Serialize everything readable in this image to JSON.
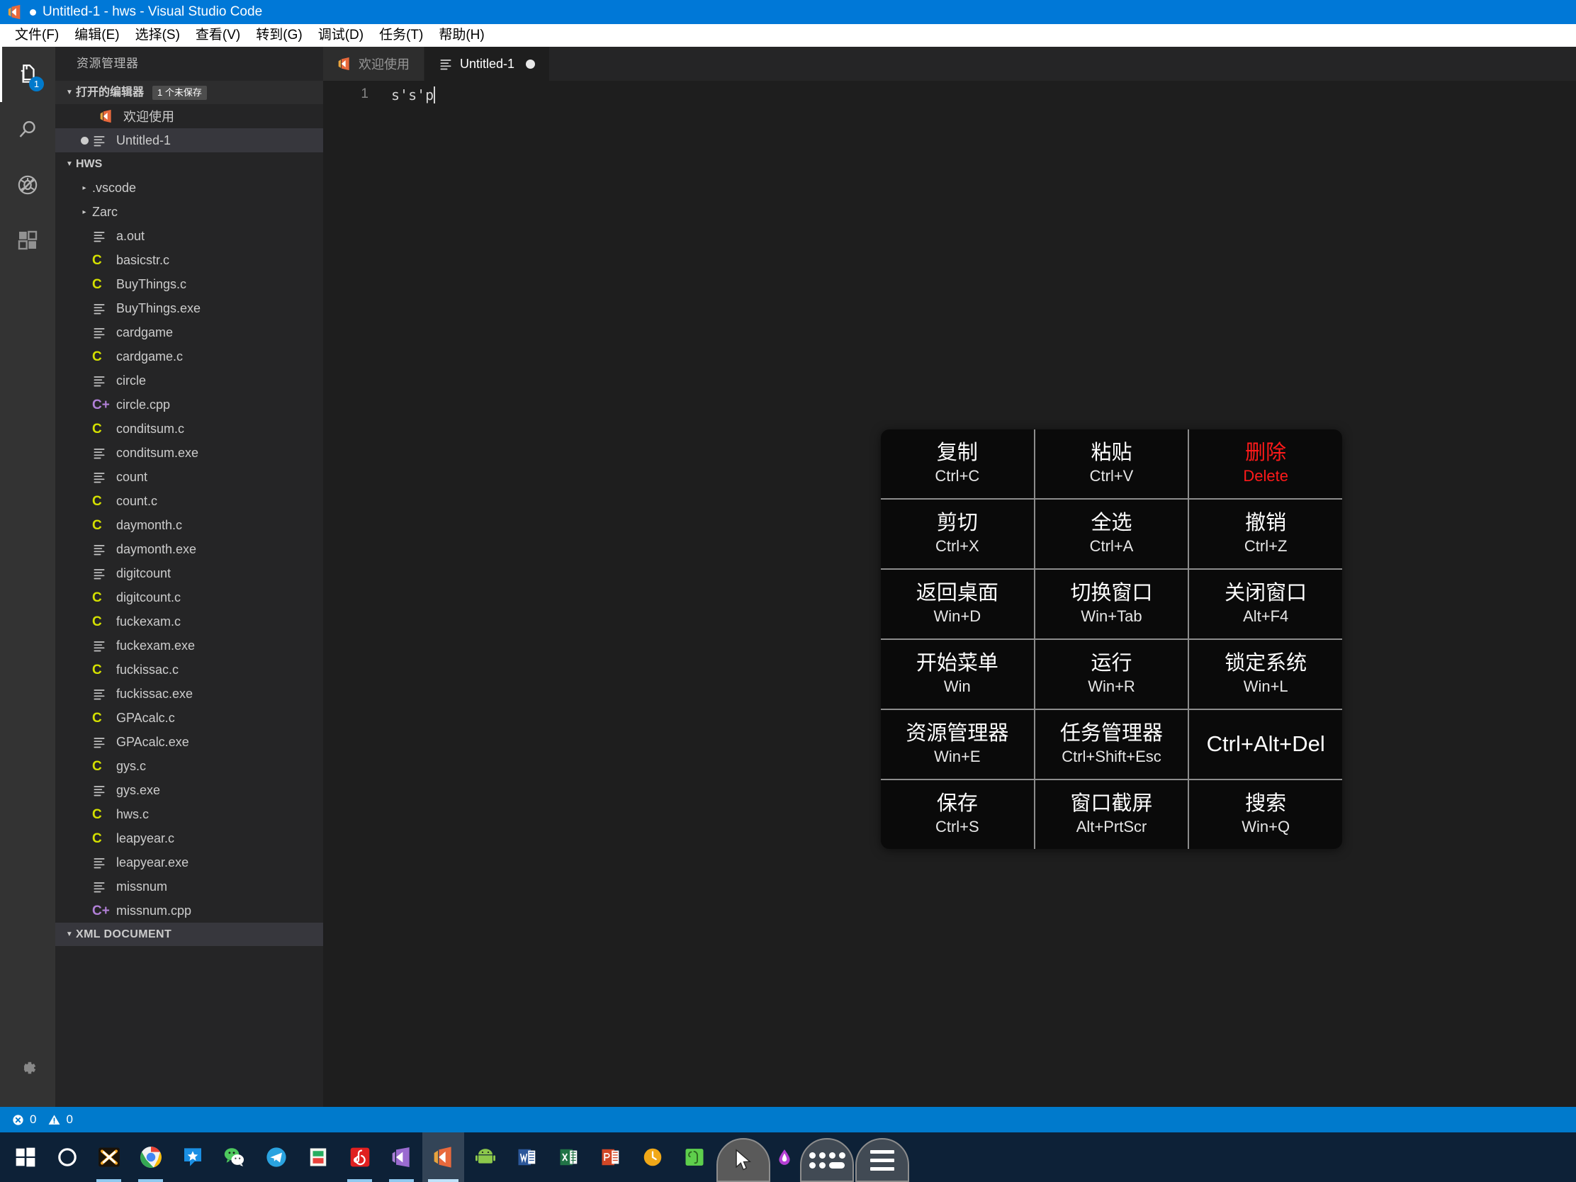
{
  "window": {
    "title": "Untitled-1 - hws - Visual Studio Code",
    "dirty": true
  },
  "menubar": {
    "items": [
      {
        "label": "文件(F)"
      },
      {
        "label": "编辑(E)"
      },
      {
        "label": "选择(S)"
      },
      {
        "label": "查看(V)"
      },
      {
        "label": "转到(G)"
      },
      {
        "label": "调试(D)"
      },
      {
        "label": "任务(T)"
      },
      {
        "label": "帮助(H)"
      }
    ]
  },
  "activitybar": {
    "items": [
      {
        "name": "explorer",
        "icon": "files-icon",
        "badge": "1",
        "active": true
      },
      {
        "name": "search",
        "icon": "search-icon",
        "badge": "",
        "active": false
      },
      {
        "name": "debug",
        "icon": "no-debug-icon",
        "badge": "",
        "active": false
      },
      {
        "name": "extensions",
        "icon": "extensions-icon",
        "badge": "",
        "active": false
      }
    ],
    "settings": {
      "name": "settings",
      "icon": "gear-icon"
    }
  },
  "sidebar": {
    "title": "资源管理器",
    "open_editors": {
      "label": "打开的编辑器",
      "badge": "1 个未保存",
      "items": [
        {
          "label": "欢迎使用",
          "icon": "vscode-icon",
          "dirty": false,
          "selected": false
        },
        {
          "label": "Untitled-1",
          "icon": "file-lines-icon",
          "dirty": true,
          "selected": true
        }
      ]
    },
    "folder": {
      "label": "HWS",
      "items": [
        {
          "label": ".vscode",
          "type": "folder"
        },
        {
          "label": "Zarc",
          "type": "folder"
        },
        {
          "label": "a.out",
          "type": "plain"
        },
        {
          "label": "basicstr.c",
          "type": "c"
        },
        {
          "label": "BuyThings.c",
          "type": "c"
        },
        {
          "label": "BuyThings.exe",
          "type": "plain"
        },
        {
          "label": "cardgame",
          "type": "plain"
        },
        {
          "label": "cardgame.c",
          "type": "c"
        },
        {
          "label": "circle",
          "type": "plain"
        },
        {
          "label": "circle.cpp",
          "type": "cpp"
        },
        {
          "label": "conditsum.c",
          "type": "c"
        },
        {
          "label": "conditsum.exe",
          "type": "plain"
        },
        {
          "label": "count",
          "type": "plain"
        },
        {
          "label": "count.c",
          "type": "c"
        },
        {
          "label": "daymonth.c",
          "type": "c"
        },
        {
          "label": "daymonth.exe",
          "type": "plain"
        },
        {
          "label": "digitcount",
          "type": "plain"
        },
        {
          "label": "digitcount.c",
          "type": "c"
        },
        {
          "label": "fuckexam.c",
          "type": "c"
        },
        {
          "label": "fuckexam.exe",
          "type": "plain"
        },
        {
          "label": "fuckissac.c",
          "type": "c"
        },
        {
          "label": "fuckissac.exe",
          "type": "plain"
        },
        {
          "label": "GPAcalc.c",
          "type": "c"
        },
        {
          "label": "GPAcalc.exe",
          "type": "plain"
        },
        {
          "label": "gys.c",
          "type": "c"
        },
        {
          "label": "gys.exe",
          "type": "plain"
        },
        {
          "label": "hws.c",
          "type": "c"
        },
        {
          "label": "leapyear.c",
          "type": "c"
        },
        {
          "label": "leapyear.exe",
          "type": "plain"
        },
        {
          "label": "missnum",
          "type": "plain"
        },
        {
          "label": "missnum.cpp",
          "type": "cpp"
        }
      ]
    },
    "xml_document": {
      "label": "XML DOCUMENT"
    }
  },
  "editor": {
    "tabs": [
      {
        "label": "欢迎使用",
        "icon": "vscode-icon",
        "active": false,
        "dirty": false
      },
      {
        "label": "Untitled-1",
        "icon": "file-lines-icon",
        "active": true,
        "dirty": true
      }
    ],
    "line_number": "1",
    "content": "s's'p"
  },
  "shortcut_panel": {
    "rows": [
      [
        {
          "label": "复制",
          "key": "Ctrl+C",
          "danger": false
        },
        {
          "label": "粘贴",
          "key": "Ctrl+V",
          "danger": false
        },
        {
          "label": "删除",
          "key": "Delete",
          "danger": true
        }
      ],
      [
        {
          "label": "剪切",
          "key": "Ctrl+X",
          "danger": false
        },
        {
          "label": "全选",
          "key": "Ctrl+A",
          "danger": false
        },
        {
          "label": "撤销",
          "key": "Ctrl+Z",
          "danger": false
        }
      ],
      [
        {
          "label": "返回桌面",
          "key": "Win+D",
          "danger": false
        },
        {
          "label": "切换窗口",
          "key": "Win+Tab",
          "danger": false
        },
        {
          "label": "关闭窗口",
          "key": "Alt+F4",
          "danger": false
        }
      ],
      [
        {
          "label": "开始菜单",
          "key": "Win",
          "danger": false
        },
        {
          "label": "运行",
          "key": "Win+R",
          "danger": false
        },
        {
          "label": "锁定系统",
          "key": "Win+L",
          "danger": false
        }
      ],
      [
        {
          "label": "资源管理器",
          "key": "Win+E",
          "danger": false
        },
        {
          "label": "任务管理器",
          "key": "Ctrl+Shift+Esc",
          "danger": false
        },
        {
          "label": "Ctrl+Alt+Del",
          "key": "",
          "danger": false
        }
      ],
      [
        {
          "label": "保存",
          "key": "Ctrl+S",
          "danger": false
        },
        {
          "label": "窗口截屏",
          "key": "Alt+PrtScr",
          "danger": false
        },
        {
          "label": "搜索",
          "key": "Win+Q",
          "danger": false
        }
      ]
    ]
  },
  "statusbar": {
    "errors": "0",
    "warnings": "0"
  },
  "taskbar": {
    "items": [
      {
        "name": "start-icon",
        "kind": "start"
      },
      {
        "name": "cortana-icon",
        "kind": "cortana"
      },
      {
        "name": "xmind-icon",
        "kind": "xmind",
        "running": true
      },
      {
        "name": "chrome-icon",
        "kind": "chrome",
        "running": true
      },
      {
        "name": "quark-icon",
        "kind": "quark"
      },
      {
        "name": "wechat-icon",
        "kind": "wechat"
      },
      {
        "name": "telegram-icon",
        "kind": "telegram"
      },
      {
        "name": "sublime-icon",
        "kind": "sublime"
      },
      {
        "name": "netease-music-icon",
        "kind": "netease",
        "running": true
      },
      {
        "name": "visual-studio-icon",
        "kind": "vs",
        "running": true
      },
      {
        "name": "vscode-icon",
        "kind": "vscode",
        "active": true
      },
      {
        "name": "android-icon",
        "kind": "android"
      },
      {
        "name": "word-icon",
        "kind": "word"
      },
      {
        "name": "excel-icon",
        "kind": "excel"
      },
      {
        "name": "powerpoint-icon",
        "kind": "ppt"
      },
      {
        "name": "clock-icon",
        "kind": "clock"
      },
      {
        "name": "evernote-icon",
        "kind": "evernote"
      }
    ],
    "tray": [
      {
        "name": "cursor-pointer-button",
        "kind": "cursor"
      },
      {
        "name": "dots-grid-button",
        "kind": "dots"
      },
      {
        "name": "hamburger-menu-button",
        "kind": "menu"
      }
    ],
    "tray_small": {
      "name": "color-drop-icon"
    }
  },
  "colors": {
    "titlebar": "#0078d7",
    "statusbar": "#007acc",
    "accent": "#007acc",
    "danger": "#ff1a1a",
    "editor_bg": "#1e1e1e",
    "sidebar_bg": "#252526"
  }
}
